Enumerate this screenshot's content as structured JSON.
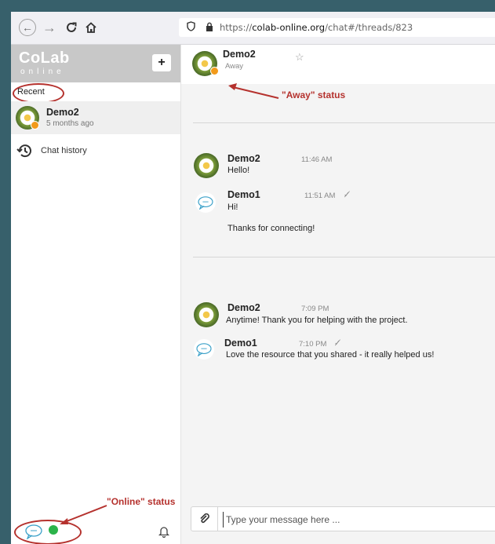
{
  "browser": {
    "url_host": "colab-online.org",
    "url_prefix": "https://",
    "url_path": "/chat#/threads/823"
  },
  "sidebar": {
    "logo_main": "CoLab",
    "logo_sub": "online",
    "new_button": "+",
    "recent_label": "Recent",
    "recent_item": {
      "name": "Demo2",
      "time": "5 months ago",
      "status_color": "#f29a1a"
    },
    "history_label": "Chat history",
    "online_annotation": "\"Online\" status",
    "online_color": "#2bb34a"
  },
  "chat": {
    "header": {
      "name": "Demo2",
      "status": "Away"
    },
    "away_annotation": "\"Away\" status",
    "messages": [
      {
        "name": "Demo2",
        "time": "11:46 AM",
        "lines": [
          "Hello!"
        ]
      },
      {
        "name": "Demo1",
        "time": "11:51 AM",
        "lines": [
          "Hi!",
          "Thanks for connecting!"
        ]
      },
      {
        "name": "Demo2",
        "time": "7:09 PM",
        "lines": [
          "Anytime! Thank you for helping with the project."
        ]
      },
      {
        "name": "Demo1",
        "time": "7:10 PM",
        "lines": [
          "Love the resource that you shared - it really helped us!"
        ]
      }
    ],
    "composer_placeholder": "Type your message here ..."
  },
  "colors": {
    "annotation": "#b5322e",
    "away": "#f29a1a",
    "online": "#2bb34a"
  }
}
